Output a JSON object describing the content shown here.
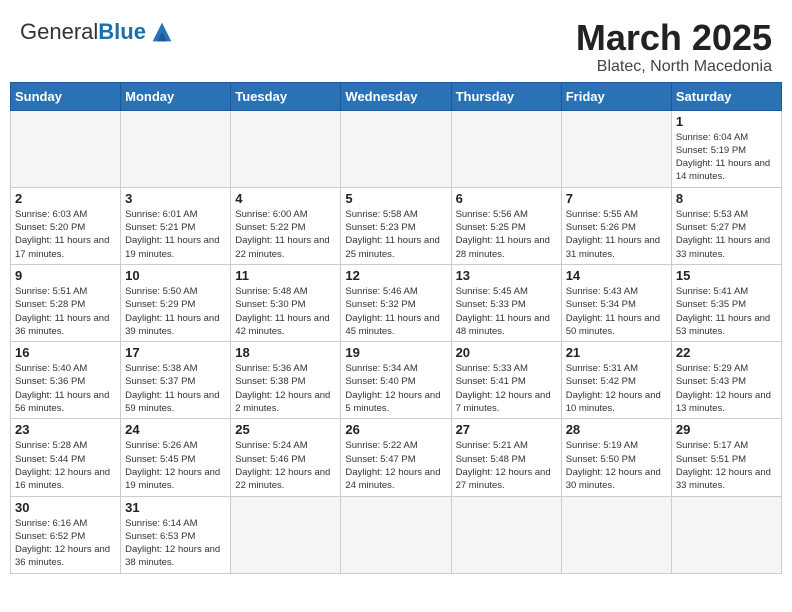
{
  "header": {
    "logo_general": "General",
    "logo_blue": "Blue",
    "title": "March 2025",
    "subtitle": "Blatec, North Macedonia"
  },
  "weekdays": [
    "Sunday",
    "Monday",
    "Tuesday",
    "Wednesday",
    "Thursday",
    "Friday",
    "Saturday"
  ],
  "weeks": [
    [
      {
        "day": "",
        "info": ""
      },
      {
        "day": "",
        "info": ""
      },
      {
        "day": "",
        "info": ""
      },
      {
        "day": "",
        "info": ""
      },
      {
        "day": "",
        "info": ""
      },
      {
        "day": "",
        "info": ""
      },
      {
        "day": "1",
        "info": "Sunrise: 6:04 AM\nSunset: 5:19 PM\nDaylight: 11 hours and 14 minutes."
      }
    ],
    [
      {
        "day": "2",
        "info": "Sunrise: 6:03 AM\nSunset: 5:20 PM\nDaylight: 11 hours and 17 minutes."
      },
      {
        "day": "3",
        "info": "Sunrise: 6:01 AM\nSunset: 5:21 PM\nDaylight: 11 hours and 19 minutes."
      },
      {
        "day": "4",
        "info": "Sunrise: 6:00 AM\nSunset: 5:22 PM\nDaylight: 11 hours and 22 minutes."
      },
      {
        "day": "5",
        "info": "Sunrise: 5:58 AM\nSunset: 5:23 PM\nDaylight: 11 hours and 25 minutes."
      },
      {
        "day": "6",
        "info": "Sunrise: 5:56 AM\nSunset: 5:25 PM\nDaylight: 11 hours and 28 minutes."
      },
      {
        "day": "7",
        "info": "Sunrise: 5:55 AM\nSunset: 5:26 PM\nDaylight: 11 hours and 31 minutes."
      },
      {
        "day": "8",
        "info": "Sunrise: 5:53 AM\nSunset: 5:27 PM\nDaylight: 11 hours and 33 minutes."
      }
    ],
    [
      {
        "day": "9",
        "info": "Sunrise: 5:51 AM\nSunset: 5:28 PM\nDaylight: 11 hours and 36 minutes."
      },
      {
        "day": "10",
        "info": "Sunrise: 5:50 AM\nSunset: 5:29 PM\nDaylight: 11 hours and 39 minutes."
      },
      {
        "day": "11",
        "info": "Sunrise: 5:48 AM\nSunset: 5:30 PM\nDaylight: 11 hours and 42 minutes."
      },
      {
        "day": "12",
        "info": "Sunrise: 5:46 AM\nSunset: 5:32 PM\nDaylight: 11 hours and 45 minutes."
      },
      {
        "day": "13",
        "info": "Sunrise: 5:45 AM\nSunset: 5:33 PM\nDaylight: 11 hours and 48 minutes."
      },
      {
        "day": "14",
        "info": "Sunrise: 5:43 AM\nSunset: 5:34 PM\nDaylight: 11 hours and 50 minutes."
      },
      {
        "day": "15",
        "info": "Sunrise: 5:41 AM\nSunset: 5:35 PM\nDaylight: 11 hours and 53 minutes."
      }
    ],
    [
      {
        "day": "16",
        "info": "Sunrise: 5:40 AM\nSunset: 5:36 PM\nDaylight: 11 hours and 56 minutes."
      },
      {
        "day": "17",
        "info": "Sunrise: 5:38 AM\nSunset: 5:37 PM\nDaylight: 11 hours and 59 minutes."
      },
      {
        "day": "18",
        "info": "Sunrise: 5:36 AM\nSunset: 5:38 PM\nDaylight: 12 hours and 2 minutes."
      },
      {
        "day": "19",
        "info": "Sunrise: 5:34 AM\nSunset: 5:40 PM\nDaylight: 12 hours and 5 minutes."
      },
      {
        "day": "20",
        "info": "Sunrise: 5:33 AM\nSunset: 5:41 PM\nDaylight: 12 hours and 7 minutes."
      },
      {
        "day": "21",
        "info": "Sunrise: 5:31 AM\nSunset: 5:42 PM\nDaylight: 12 hours and 10 minutes."
      },
      {
        "day": "22",
        "info": "Sunrise: 5:29 AM\nSunset: 5:43 PM\nDaylight: 12 hours and 13 minutes."
      }
    ],
    [
      {
        "day": "23",
        "info": "Sunrise: 5:28 AM\nSunset: 5:44 PM\nDaylight: 12 hours and 16 minutes."
      },
      {
        "day": "24",
        "info": "Sunrise: 5:26 AM\nSunset: 5:45 PM\nDaylight: 12 hours and 19 minutes."
      },
      {
        "day": "25",
        "info": "Sunrise: 5:24 AM\nSunset: 5:46 PM\nDaylight: 12 hours and 22 minutes."
      },
      {
        "day": "26",
        "info": "Sunrise: 5:22 AM\nSunset: 5:47 PM\nDaylight: 12 hours and 24 minutes."
      },
      {
        "day": "27",
        "info": "Sunrise: 5:21 AM\nSunset: 5:48 PM\nDaylight: 12 hours and 27 minutes."
      },
      {
        "day": "28",
        "info": "Sunrise: 5:19 AM\nSunset: 5:50 PM\nDaylight: 12 hours and 30 minutes."
      },
      {
        "day": "29",
        "info": "Sunrise: 5:17 AM\nSunset: 5:51 PM\nDaylight: 12 hours and 33 minutes."
      }
    ],
    [
      {
        "day": "30",
        "info": "Sunrise: 6:16 AM\nSunset: 6:52 PM\nDaylight: 12 hours and 36 minutes."
      },
      {
        "day": "31",
        "info": "Sunrise: 6:14 AM\nSunset: 6:53 PM\nDaylight: 12 hours and 38 minutes."
      },
      {
        "day": "",
        "info": ""
      },
      {
        "day": "",
        "info": ""
      },
      {
        "day": "",
        "info": ""
      },
      {
        "day": "",
        "info": ""
      },
      {
        "day": "",
        "info": ""
      }
    ]
  ]
}
